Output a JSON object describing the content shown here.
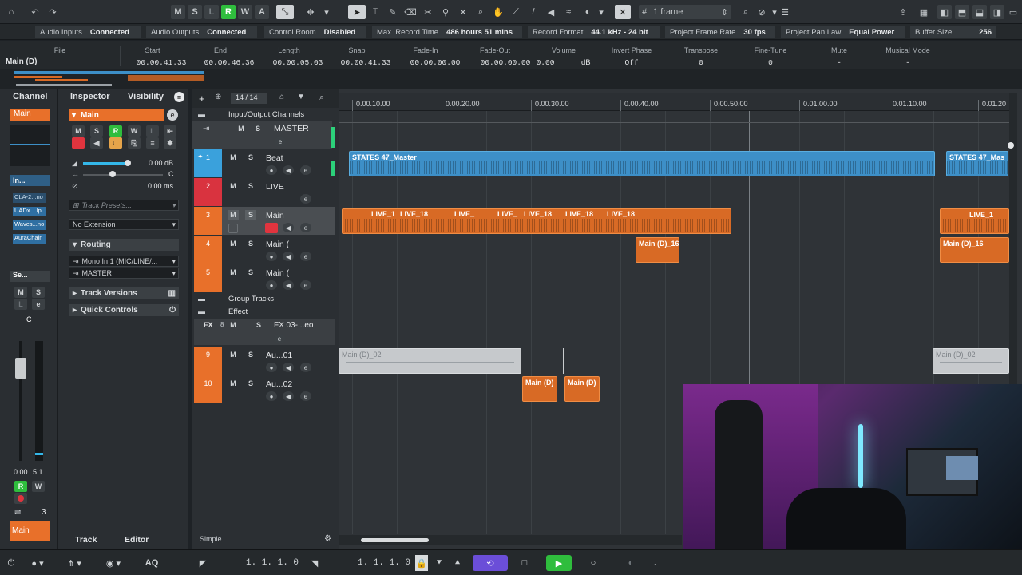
{
  "toolbar": {
    "mode_buttons": [
      "M",
      "S",
      "L",
      "R",
      "W",
      "A"
    ],
    "frame_label": "1 frame"
  },
  "status": [
    {
      "label": "Audio Inputs",
      "value": "Connected"
    },
    {
      "label": "Audio Outputs",
      "value": "Connected"
    },
    {
      "label": "Control Room",
      "value": "Disabled"
    },
    {
      "label": "Max. Record Time",
      "value": "486 hours 51 mins"
    },
    {
      "label": "Record Format",
      "value": "44.1 kHz - 24 bit"
    },
    {
      "label": "Project Frame Rate",
      "value": "30 fps"
    },
    {
      "label": "Project Pan Law",
      "value": "Equal Power"
    },
    {
      "label": "Buffer Size",
      "value": "256"
    }
  ],
  "infoline": {
    "selected": "Main (D)",
    "headers": [
      "File",
      "Start",
      "End",
      "Length",
      "Snap",
      "Fade-In",
      "Fade-Out",
      "Volume",
      "Invert Phase",
      "Transpose",
      "Fine-Tune",
      "Mute",
      "Musical Mode"
    ],
    "values": [
      "",
      "00.00.41.33",
      "00.00.46.36",
      "00.00.05.03",
      "00.00.41.33",
      "00.00.00.00",
      "00.00.00.00",
      "0.00",
      "Off",
      "0",
      "0",
      "-",
      "-"
    ],
    "volume_unit": "dB"
  },
  "left": {
    "tab_channel": "Channel",
    "tab_inspector": "Inspector",
    "tab_visibility": "Visibility",
    "channel_name": "Main",
    "inserts_label": "In...",
    "plugins": [
      "CLA-2...no",
      "UADx ...lp",
      "Waves...no",
      "AuraChain"
    ],
    "sends_label": "Se...",
    "fader_values": [
      "0.00",
      "5.1"
    ],
    "pan_value": "C",
    "num3": "3",
    "bottom_name": "Main",
    "inspector_track": "Main",
    "volume": "0.00 dB",
    "pan": "C",
    "delay": "0.00 ms",
    "presets_placeholder": "Track Presets...",
    "extension": "No Extension",
    "routing": "Routing",
    "input": "Mono In 1 (MIC/LINE/...",
    "output": "MASTER",
    "track_versions": "Track Versions",
    "quick_controls": "Quick Controls",
    "bottom_tab_track": "Track",
    "bottom_tab_editor": "Editor"
  },
  "tracklist": {
    "count": "14 / 14",
    "io_folder": "Input/Output Channels",
    "master": "MASTER",
    "tracks": [
      {
        "num": "1",
        "name": "Beat",
        "color": "#3aa1dc"
      },
      {
        "num": "2",
        "name": "LIVE",
        "color": "#d9333f"
      },
      {
        "num": "3",
        "name": "Main",
        "color": "#e8702a"
      },
      {
        "num": "4",
        "name": "Main (",
        "color": "#e8702a"
      },
      {
        "num": "5",
        "name": "Main (",
        "color": "#e8702a"
      }
    ],
    "group_folder": "Group Tracks",
    "effect_folder": "Effect",
    "fx": {
      "num": "8",
      "label": "FX",
      "name": "FX 03-...eo"
    },
    "tracks2": [
      {
        "num": "9",
        "name": "Au...01",
        "color": "#e8702a"
      },
      {
        "num": "10",
        "name": "Au...02",
        "color": "#e8702a"
      }
    ],
    "simple": "Simple"
  },
  "ruler": [
    "0.00.10.00",
    "0.00.20.00",
    "0.00.30.00",
    "0.00.40.00",
    "0.00.50.00",
    "0.01.00.00",
    "0.01.10.00",
    "0.01.20"
  ],
  "events": {
    "beat": [
      "STATES 47_Master",
      "STATES 47_Mas"
    ],
    "live": [
      "LIVE_1",
      "LIVE_18",
      "LIVE_",
      "LIVE_",
      "LIVE_18",
      "LIVE_18",
      "LIVE_18",
      "LIVE_1"
    ],
    "main16a": "Main (D)_16",
    "main16b": "Main (D)_16",
    "au01a": "Main (D)_02",
    "au01b": "Main (D)_02",
    "au02": [
      "Main (D)",
      "Main (D)"
    ]
  },
  "transport": {
    "left_pos": "1. 1. 1.    0",
    "right_pos": "1. 1. 1.    0",
    "aq": "AQ"
  }
}
